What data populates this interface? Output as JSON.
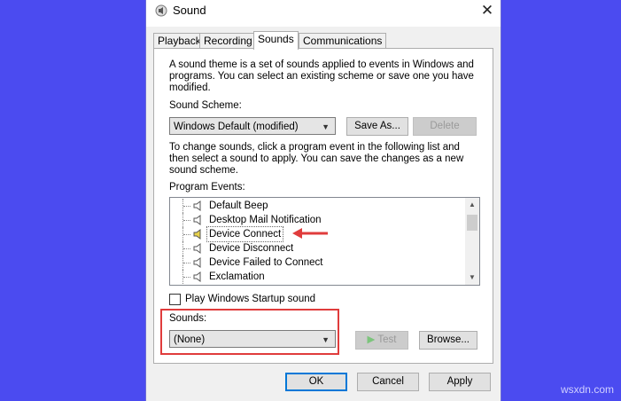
{
  "window": {
    "title": "Sound",
    "close_glyph": "✕"
  },
  "tabs": [
    {
      "label": "Playback"
    },
    {
      "label": "Recording"
    },
    {
      "label": "Sounds"
    },
    {
      "label": "Communications"
    }
  ],
  "intro_text": "A sound theme is a set of sounds applied to events in Windows and programs.  You can select an existing scheme or save one you have modified.",
  "scheme": {
    "label": "Sound Scheme:",
    "selected": "Windows Default (modified)",
    "save_as_label": "Save As...",
    "delete_label": "Delete"
  },
  "instructions_text": "To change sounds, click a program event in the following list and then select a sound to apply.  You can save the changes as a new sound scheme.",
  "events": {
    "label": "Program Events:",
    "items": [
      {
        "label": "Default Beep"
      },
      {
        "label": "Desktop Mail Notification"
      },
      {
        "label": "Device Connect"
      },
      {
        "label": "Device Disconnect"
      },
      {
        "label": "Device Failed to Connect"
      },
      {
        "label": "Exclamation"
      }
    ],
    "selected_item": "Device Connect"
  },
  "startup_sound": {
    "label": "Play Windows Startup sound",
    "checked": false
  },
  "sounds": {
    "label": "Sounds:",
    "selected": "(None)",
    "test_label": "Test",
    "browse_label": "Browse..."
  },
  "footer": {
    "ok_label": "OK",
    "cancel_label": "Cancel",
    "apply_label": "Apply"
  },
  "watermark": "wsxdn.com",
  "colors": {
    "background": "#4b4bf0",
    "annotation_red": "#e03c3c",
    "focus_blue": "#0078d7"
  }
}
